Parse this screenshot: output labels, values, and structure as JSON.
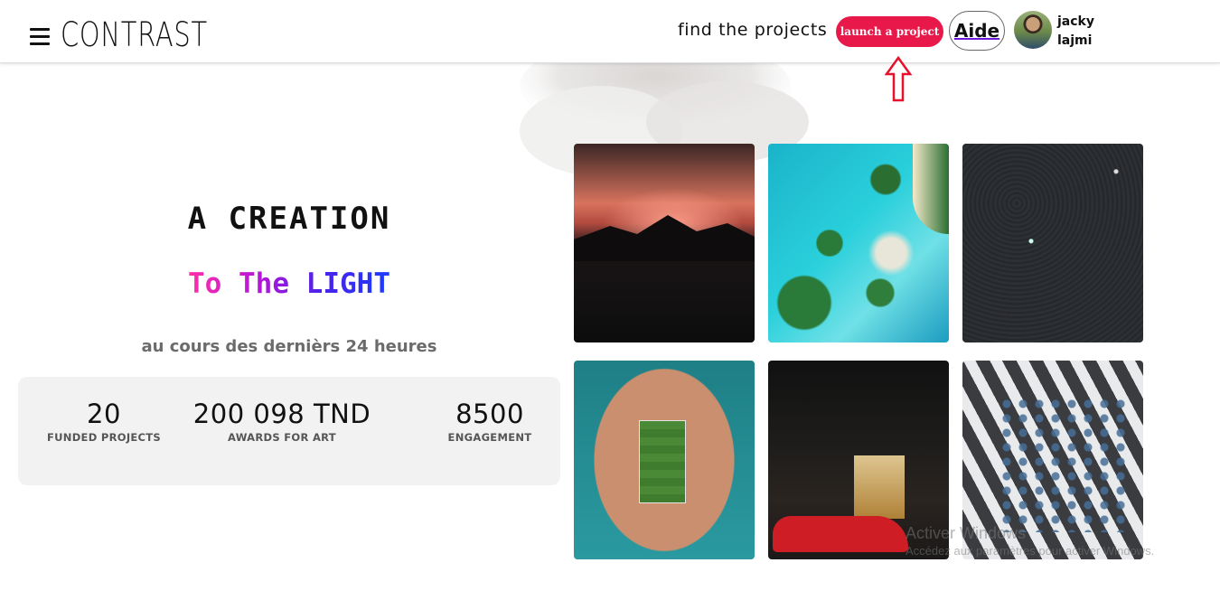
{
  "header": {
    "logo_text": "CONTRAST",
    "nav_link": "find the projects",
    "launch_button": "launch a project",
    "help_button": "Aide",
    "user": {
      "first_name": "jacky",
      "last_name": "lajmi"
    }
  },
  "hero": {
    "title": "A CREATION",
    "subtitle": "To The LIGHT",
    "caption": "au cours des dernièrs 24 heures"
  },
  "stats": [
    {
      "value": "20",
      "label": "FUNDED PROJECTS"
    },
    {
      "value": "200 098 TND",
      "label": "AWARDS FOR ART"
    },
    {
      "value": "8500",
      "label": "ENGAGEMENT"
    }
  ],
  "gallery": [
    "sunset-mountains",
    "tropical-islands",
    "night-sea-boat",
    "island-football-field",
    "hotel-entrance-red-car",
    "crosswalk-umbrellas"
  ],
  "watermark": {
    "line1": "Activer Windows",
    "line2": "Accédez aux paramètres pour activer Windows."
  },
  "colors": {
    "accent": "#e8194a",
    "subtitle_gradient": [
      "#ff2fa8",
      "#b517d8",
      "#1a3cff"
    ],
    "stats_background": "#f2f2f2"
  }
}
